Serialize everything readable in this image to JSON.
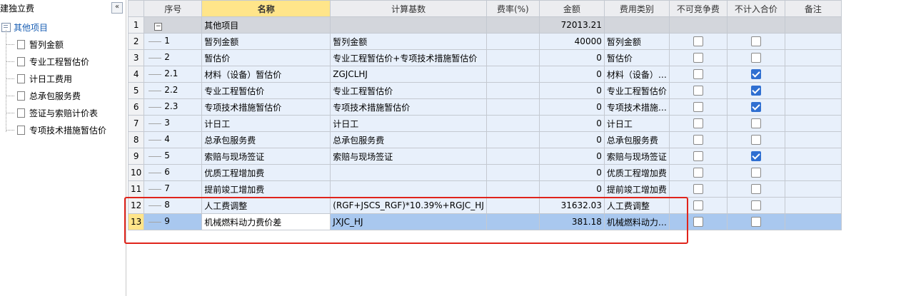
{
  "left_panel": {
    "title": "建独立费",
    "collapse_glyph": "«",
    "root_label": "其他项目",
    "items": [
      "暂列金额",
      "专业工程暂估价",
      "计日工费用",
      "总承包服务费",
      "签证与索赔计价表",
      "专项技术措施暂估价"
    ]
  },
  "grid": {
    "headers": [
      "序号",
      "名称",
      "计算基数",
      "费率(%)",
      "金额",
      "费用类别",
      "不可竞争费",
      "不计入合价",
      "备注"
    ],
    "rows": [
      {
        "rownum": "1",
        "seq": "",
        "name": "其他项目",
        "base": "",
        "rate": "",
        "amount": "72013.21",
        "category": "",
        "noncomp": null,
        "excl": null,
        "note": "",
        "type": "group",
        "expander": "−"
      },
      {
        "rownum": "2",
        "seq": "1",
        "name": "暂列金额",
        "base": "暂列金额",
        "rate": "",
        "amount": "40000",
        "category": "暂列金额",
        "noncomp": false,
        "excl": false,
        "note": "",
        "type": "data"
      },
      {
        "rownum": "3",
        "seq": "2",
        "name": "暂估价",
        "base": "专业工程暂估价+专项技术措施暂估价",
        "rate": "",
        "amount": "0",
        "category": "暂估价",
        "noncomp": false,
        "excl": false,
        "note": "",
        "type": "data"
      },
      {
        "rownum": "4",
        "seq": "2.1",
        "name": "材料（设备）暂估价",
        "base": "ZGJCLHJ",
        "rate": "",
        "amount": "0",
        "category": "材料（设备）…",
        "noncomp": false,
        "excl": true,
        "note": "",
        "type": "data"
      },
      {
        "rownum": "5",
        "seq": "2.2",
        "name": "专业工程暂估价",
        "base": "专业工程暂估价",
        "rate": "",
        "amount": "0",
        "category": "专业工程暂估价",
        "noncomp": false,
        "excl": true,
        "note": "",
        "type": "data"
      },
      {
        "rownum": "6",
        "seq": "2.3",
        "name": "专项技术措施暂估价",
        "base": "专项技术措施暂估价",
        "rate": "",
        "amount": "0",
        "category": "专项技术措施…",
        "noncomp": false,
        "excl": true,
        "note": "",
        "type": "data"
      },
      {
        "rownum": "7",
        "seq": "3",
        "name": "计日工",
        "base": "计日工",
        "rate": "",
        "amount": "0",
        "category": "计日工",
        "noncomp": false,
        "excl": false,
        "note": "",
        "type": "data"
      },
      {
        "rownum": "8",
        "seq": "4",
        "name": "总承包服务费",
        "base": "总承包服务费",
        "rate": "",
        "amount": "0",
        "category": "总承包服务费",
        "noncomp": false,
        "excl": false,
        "note": "",
        "type": "data"
      },
      {
        "rownum": "9",
        "seq": "5",
        "name": "索赔与现场签证",
        "base": "索赔与现场签证",
        "rate": "",
        "amount": "0",
        "category": "索赔与现场签证",
        "noncomp": false,
        "excl": true,
        "note": "",
        "type": "data"
      },
      {
        "rownum": "10",
        "seq": "6",
        "name": "优质工程增加费",
        "base": "",
        "rate": "",
        "amount": "0",
        "category": "优质工程增加费",
        "noncomp": false,
        "excl": false,
        "note": "",
        "type": "data"
      },
      {
        "rownum": "11",
        "seq": "7",
        "name": "提前竣工增加费",
        "base": "",
        "rate": "",
        "amount": "0",
        "category": "提前竣工增加费",
        "noncomp": false,
        "excl": false,
        "note": "",
        "type": "data"
      },
      {
        "rownum": "12",
        "seq": "8",
        "name": "人工费调整",
        "base": "(RGF+JSCS_RGF)*10.39%+RGJC_HJ",
        "rate": "",
        "amount": "31632.03",
        "category": "人工费调整",
        "noncomp": false,
        "excl": false,
        "note": "",
        "type": "data"
      },
      {
        "rownum": "13",
        "seq": "9",
        "name": "机械燃料动力费价差",
        "base": "JXJC_HJ",
        "rate": "",
        "amount": "381.18",
        "category": "机械燃料动力…",
        "noncomp": false,
        "excl": false,
        "note": "",
        "type": "selected"
      }
    ]
  }
}
